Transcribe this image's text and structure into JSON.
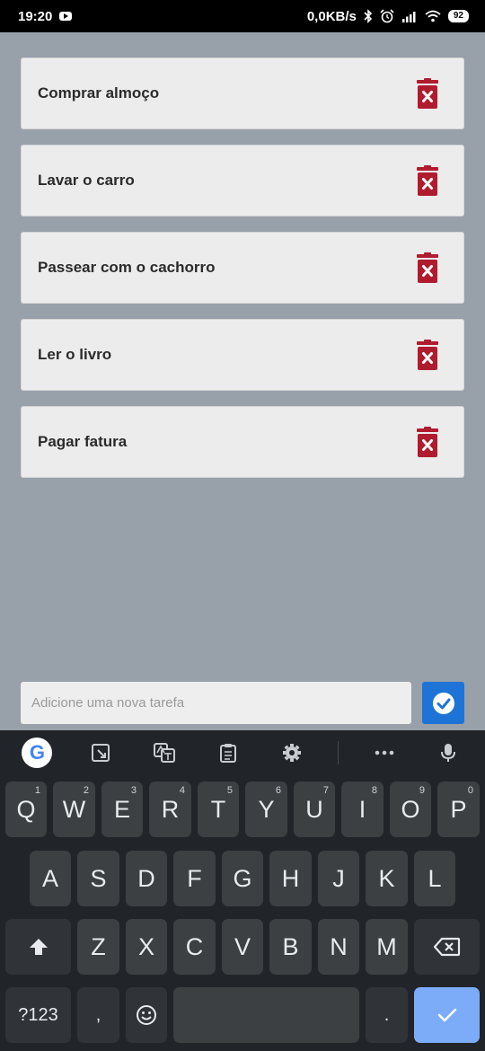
{
  "status_bar": {
    "time": "19:20",
    "network_speed": "0,0KB/s",
    "battery": "92",
    "icons": [
      "youtube-icon",
      "bluetooth-icon",
      "alarm-icon",
      "signal-icon",
      "wifi-icon",
      "battery-icon"
    ]
  },
  "tasks": [
    {
      "text": "Comprar almoço"
    },
    {
      "text": "Lavar o carro"
    },
    {
      "text": "Passear com o cachorro"
    },
    {
      "text": "Ler o livro"
    },
    {
      "text": "Pagar fatura"
    }
  ],
  "input": {
    "placeholder": "Adicione uma nova tarefa",
    "value": ""
  },
  "colors": {
    "background": "#98a0aa",
    "card": "#ececec",
    "delete": "#b01c2e",
    "confirm": "#1e74d6",
    "keyboard": "#212529",
    "key": "#3c4043",
    "enter_key": "#7cacf8"
  },
  "keyboard": {
    "toolbar": [
      "google-icon",
      "sticker-icon",
      "translate-icon",
      "clipboard-icon",
      "settings-icon",
      "more-icon",
      "mic-icon"
    ],
    "google_label": "G",
    "row1": [
      {
        "label": "Q",
        "hint": "1"
      },
      {
        "label": "W",
        "hint": "2"
      },
      {
        "label": "E",
        "hint": "3"
      },
      {
        "label": "R",
        "hint": "4"
      },
      {
        "label": "T",
        "hint": "5"
      },
      {
        "label": "Y",
        "hint": "6"
      },
      {
        "label": "U",
        "hint": "7"
      },
      {
        "label": "I",
        "hint": "8"
      },
      {
        "label": "O",
        "hint": "9"
      },
      {
        "label": "P",
        "hint": "0"
      }
    ],
    "row2": [
      "A",
      "S",
      "D",
      "F",
      "G",
      "H",
      "J",
      "K",
      "L"
    ],
    "row3": [
      "Z",
      "X",
      "C",
      "V",
      "B",
      "N",
      "M"
    ],
    "symbols_label": "?123",
    "comma_label": ",",
    "period_label": "."
  }
}
